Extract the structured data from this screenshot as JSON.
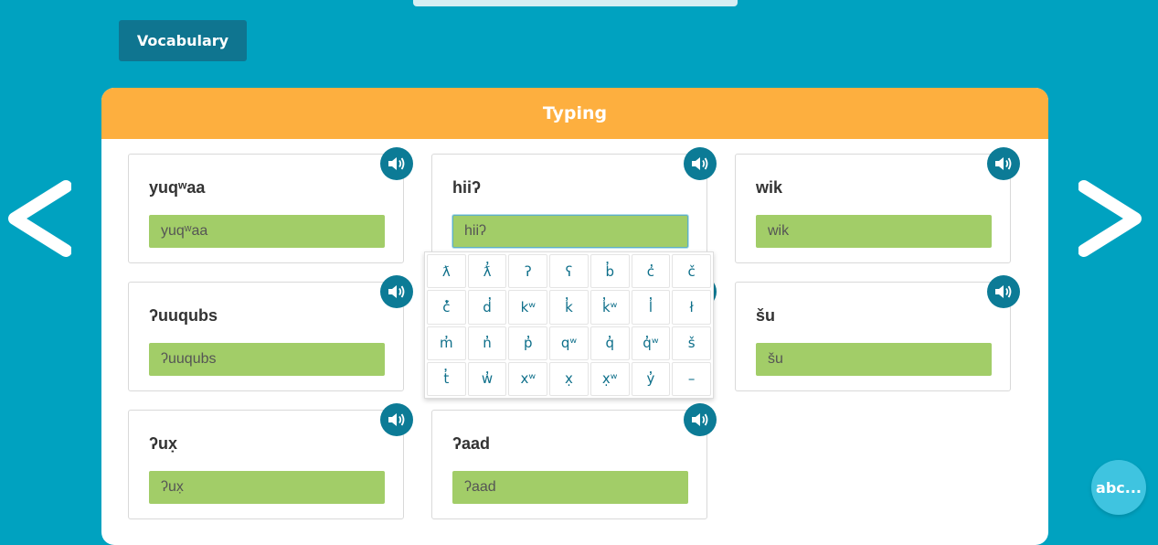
{
  "tab": {
    "label": "Vocabulary"
  },
  "panel": {
    "title": "Typing"
  },
  "cards": [
    {
      "word": "yuqʷaa",
      "answer": "yuqʷaa"
    },
    {
      "word": "hiiʔ",
      "answer": "hiiʔ"
    },
    {
      "word": "wik",
      "answer": "wik"
    },
    {
      "word": "ʔuuqubs",
      "answer": "ʔuuqubs"
    },
    {
      "word": "šu",
      "answer": "šu"
    },
    {
      "word": "ʔux̣",
      "answer": "ʔux̣"
    },
    {
      "word": "ʔaad",
      "answer": "ʔaad"
    }
  ],
  "keyboard": {
    "keys": [
      "ƛ",
      "ƛ̓",
      "ʔ",
      "ʕ",
      "b̓",
      "c̓",
      "č",
      "č̓",
      "d̓",
      "kʷ",
      "k̓",
      "k̓ʷ",
      "l̓",
      "ł",
      "m̓",
      "n̓",
      "p̓",
      "qʷ",
      "q̓",
      "q̓ʷ",
      "š",
      "t̓",
      "w̓",
      "xʷ",
      "x̣",
      "x̣ʷ",
      "y̓",
      "–"
    ]
  },
  "abc_button": {
    "label": "abc..."
  },
  "icons": {
    "sound": "speaker-icon",
    "prev": "chevron-left-icon",
    "next": "chevron-right-icon"
  },
  "colors": {
    "background": "#00a2c0",
    "header": "#fdaf3f",
    "answer_fill": "#a2cd68",
    "sound_button": "#0c7b96",
    "tab": "#0f7590"
  }
}
